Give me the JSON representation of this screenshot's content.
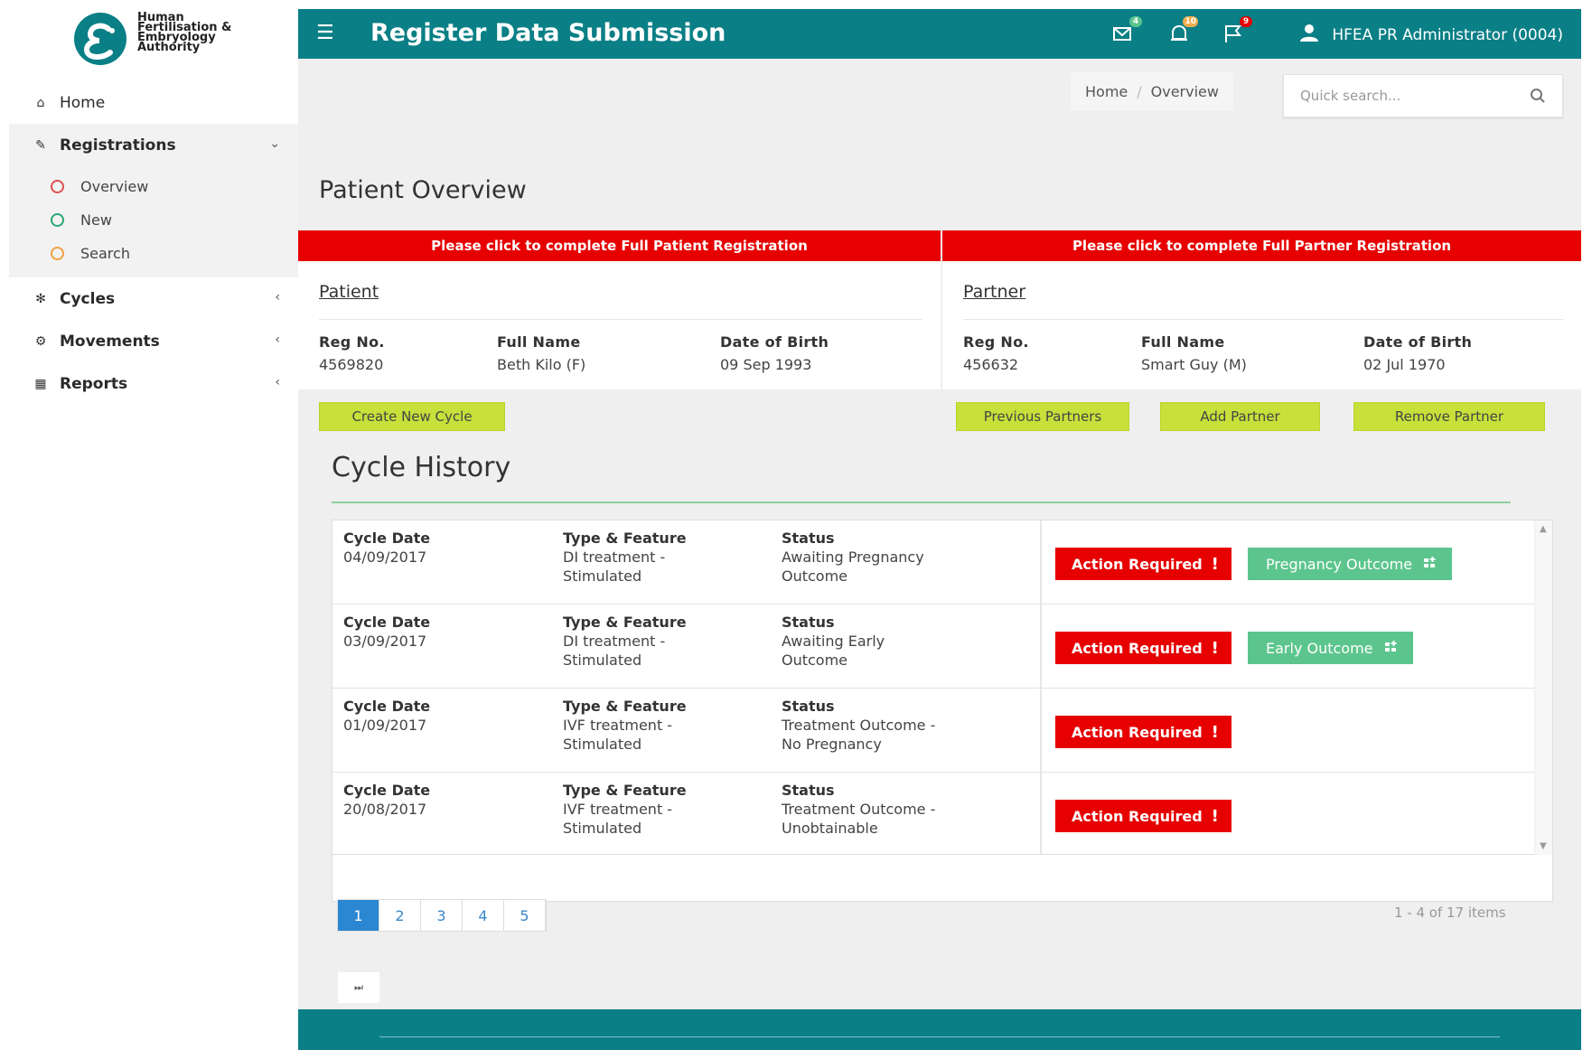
{
  "brand": {
    "lines": [
      "Human",
      "Fertilisation &",
      "Embryology",
      "Authority"
    ],
    "color": "#0a7f86"
  },
  "header": {
    "menu_icon": "hamburger-icon",
    "title": "Register Data Submission",
    "notifications": [
      {
        "icon": "envelope-icon",
        "badge": "4",
        "badge_color": "#5cc58d"
      },
      {
        "icon": "bell-icon",
        "badge": "10",
        "badge_color": "#f0ad4e"
      },
      {
        "icon": "flag-icon",
        "badge": "9",
        "badge_color": "#e60000"
      }
    ],
    "user": "HFEA PR Administrator (0004)"
  },
  "sidebar": {
    "items": [
      {
        "label": "Home",
        "icon": "home-icon"
      },
      {
        "label": "Registrations",
        "icon": "edit-icon",
        "expanded": true
      },
      {
        "label": "Cycles",
        "icon": "spinner-icon"
      },
      {
        "label": "Movements",
        "icon": "cogs-icon"
      },
      {
        "label": "Reports",
        "icon": "table-icon"
      }
    ],
    "subitems": [
      {
        "label": "Overview",
        "color": "#e05050"
      },
      {
        "label": "New",
        "color": "#2aa876"
      },
      {
        "label": "Search",
        "color": "#f0a040"
      }
    ]
  },
  "breadcrumb": {
    "home": "Home",
    "current": "Overview"
  },
  "search": {
    "placeholder": "Quick search..."
  },
  "page_title": "Patient Overview",
  "banners": {
    "patient": "Please click to complete Full Patient Registration",
    "partner": "Please click to complete Full Partner Registration"
  },
  "patient": {
    "title": "Patient",
    "labels": {
      "reg": "Reg No.",
      "name": "Full Name",
      "dob": "Date of Birth"
    },
    "reg": "4569820",
    "name": "Beth Kilo (F)",
    "dob": "09 Sep 1993"
  },
  "partner": {
    "title": "Partner",
    "labels": {
      "reg": "Reg No.",
      "name": "Full Name",
      "dob": "Date of Birth"
    },
    "reg": "456632",
    "name": "Smart Guy (M)",
    "dob": "02 Jul 1970"
  },
  "buttons": {
    "create_cycle": "Create New Cycle",
    "previous_partners": "Previous Partners",
    "add_partner": "Add Partner",
    "remove_partner": "Remove Partner"
  },
  "cycle_history": {
    "title": "Cycle History",
    "headers": {
      "date": "Cycle Date",
      "type": "Type & Feature",
      "status": "Status"
    },
    "action_label": "Action Required",
    "rows": [
      {
        "date": "04/09/2017",
        "type": [
          "DI treatment -",
          "Stimulated"
        ],
        "status": [
          "Awaiting Pregnancy",
          "Outcome"
        ],
        "extra": "Pregnancy Outcome"
      },
      {
        "date": "03/09/2017",
        "type": [
          "DI treatment -",
          "Stimulated"
        ],
        "status": [
          "Awaiting Early",
          "Outcome"
        ],
        "extra": "Early Outcome"
      },
      {
        "date": "01/09/2017",
        "type": [
          "IVF treatment -",
          "Stimulated"
        ],
        "status": [
          "Treatment Outcome -",
          "No Pregnancy"
        ],
        "extra": ""
      },
      {
        "date": "20/08/2017",
        "type": [
          "IVF treatment -",
          "Stimulated"
        ],
        "status": [
          "Treatment Outcome -",
          "Unobtainable"
        ],
        "extra": ""
      }
    ]
  },
  "pager": {
    "pages": [
      "1",
      "2",
      "3",
      "4",
      "5"
    ],
    "current": "1",
    "info": "1 - 4 of 17 items"
  }
}
